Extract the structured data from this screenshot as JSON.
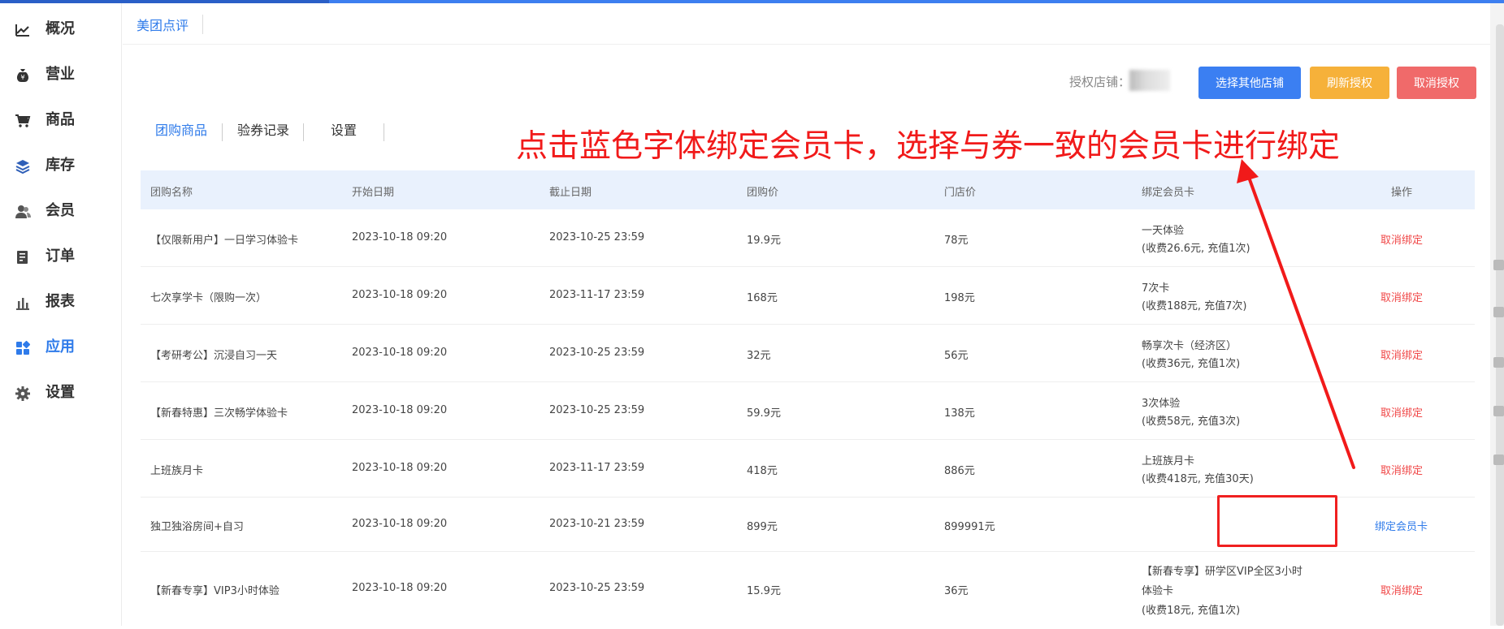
{
  "colors": {
    "accent": "#2f7bea",
    "danger": "#f04848",
    "warning": "#f6b13a",
    "annotation": "#f11a1a",
    "header_bg": "#e9f1fd"
  },
  "sidebar": {
    "items": [
      {
        "label": "概况",
        "icon": "chart-line-icon",
        "active": false
      },
      {
        "label": "营业",
        "icon": "money-bag-icon",
        "active": false
      },
      {
        "label": "商品",
        "icon": "cart-icon",
        "active": false
      },
      {
        "label": "库存",
        "icon": "layers-icon",
        "active": false
      },
      {
        "label": "会员",
        "icon": "users-icon",
        "active": false
      },
      {
        "label": "订单",
        "icon": "order-icon",
        "active": false
      },
      {
        "label": "报表",
        "icon": "bar-chart-icon",
        "active": false
      },
      {
        "label": "应用",
        "icon": "apps-icon",
        "active": true
      },
      {
        "label": "设置",
        "icon": "gear-icon",
        "active": false
      }
    ]
  },
  "breadcrumb": {
    "label": "美团点评"
  },
  "auth": {
    "label": "授权店铺：",
    "select_other": "选择其他店铺",
    "refresh": "刷新授权",
    "cancel": "取消授权"
  },
  "tabs": [
    {
      "label": "团购商品",
      "active": true
    },
    {
      "label": "验券记录",
      "active": false
    },
    {
      "label": "设置",
      "active": false
    }
  ],
  "annotation": {
    "text": "点击蓝色字体绑定会员卡，选择与券一致的会员卡进行绑定"
  },
  "table": {
    "columns": [
      "团购名称",
      "开始日期",
      "截止日期",
      "团购价",
      "门店价",
      "绑定会员卡",
      "操作"
    ],
    "rows": [
      {
        "name": "【仅限新用户】一日学习体验卡",
        "start": "2023-10-18 09:20",
        "end": "2023-10-25 23:59",
        "price": "19.9元",
        "store_price": "78元",
        "card_lines": [
          "一天体验",
          "(收费26.6元, 充值1次)"
        ],
        "action": "取消绑定"
      },
      {
        "name": "七次享学卡（限购一次）",
        "start": "2023-10-18 09:20",
        "end": "2023-11-17 23:59",
        "price": "168元",
        "store_price": "198元",
        "card_lines": [
          "7次卡",
          "(收费188元, 充值7次)"
        ],
        "action": "取消绑定"
      },
      {
        "name": "【考研考公】沉浸自习一天",
        "start": "2023-10-18 09:20",
        "end": "2023-10-25 23:59",
        "price": "32元",
        "store_price": "56元",
        "card_lines": [
          "畅享次卡（经济区）",
          "(收费36元, 充值1次)"
        ],
        "action": "取消绑定"
      },
      {
        "name": "【新春特惠】三次畅学体验卡",
        "start": "2023-10-18 09:20",
        "end": "2023-10-25 23:59",
        "price": "59.9元",
        "store_price": "138元",
        "card_lines": [
          "3次体验",
          "(收费58元, 充值3次)"
        ],
        "action": "取消绑定"
      },
      {
        "name": "上班族月卡",
        "start": "2023-10-18 09:20",
        "end": "2023-11-17 23:59",
        "price": "418元",
        "store_price": "886元",
        "card_lines": [
          "上班族月卡",
          "(收费418元, 充值30天)"
        ],
        "action": "取消绑定"
      },
      {
        "name": "独卫独浴房间+自习",
        "start": "2023-10-18 09:20",
        "end": "2023-10-21 23:59",
        "price": "899元",
        "store_price": "899991元",
        "card_lines": [],
        "action": "绑定会员卡"
      },
      {
        "name": "【新春专享】VIP3小时体验",
        "start": "2023-10-18 09:20",
        "end": "2023-10-25 23:59",
        "price": "15.9元",
        "store_price": "36元",
        "card_lines": [
          "【新春专享】研学区VIP全区3小时",
          "体验卡",
          "(收费18元, 充值1次)"
        ],
        "action": "取消绑定"
      }
    ]
  }
}
